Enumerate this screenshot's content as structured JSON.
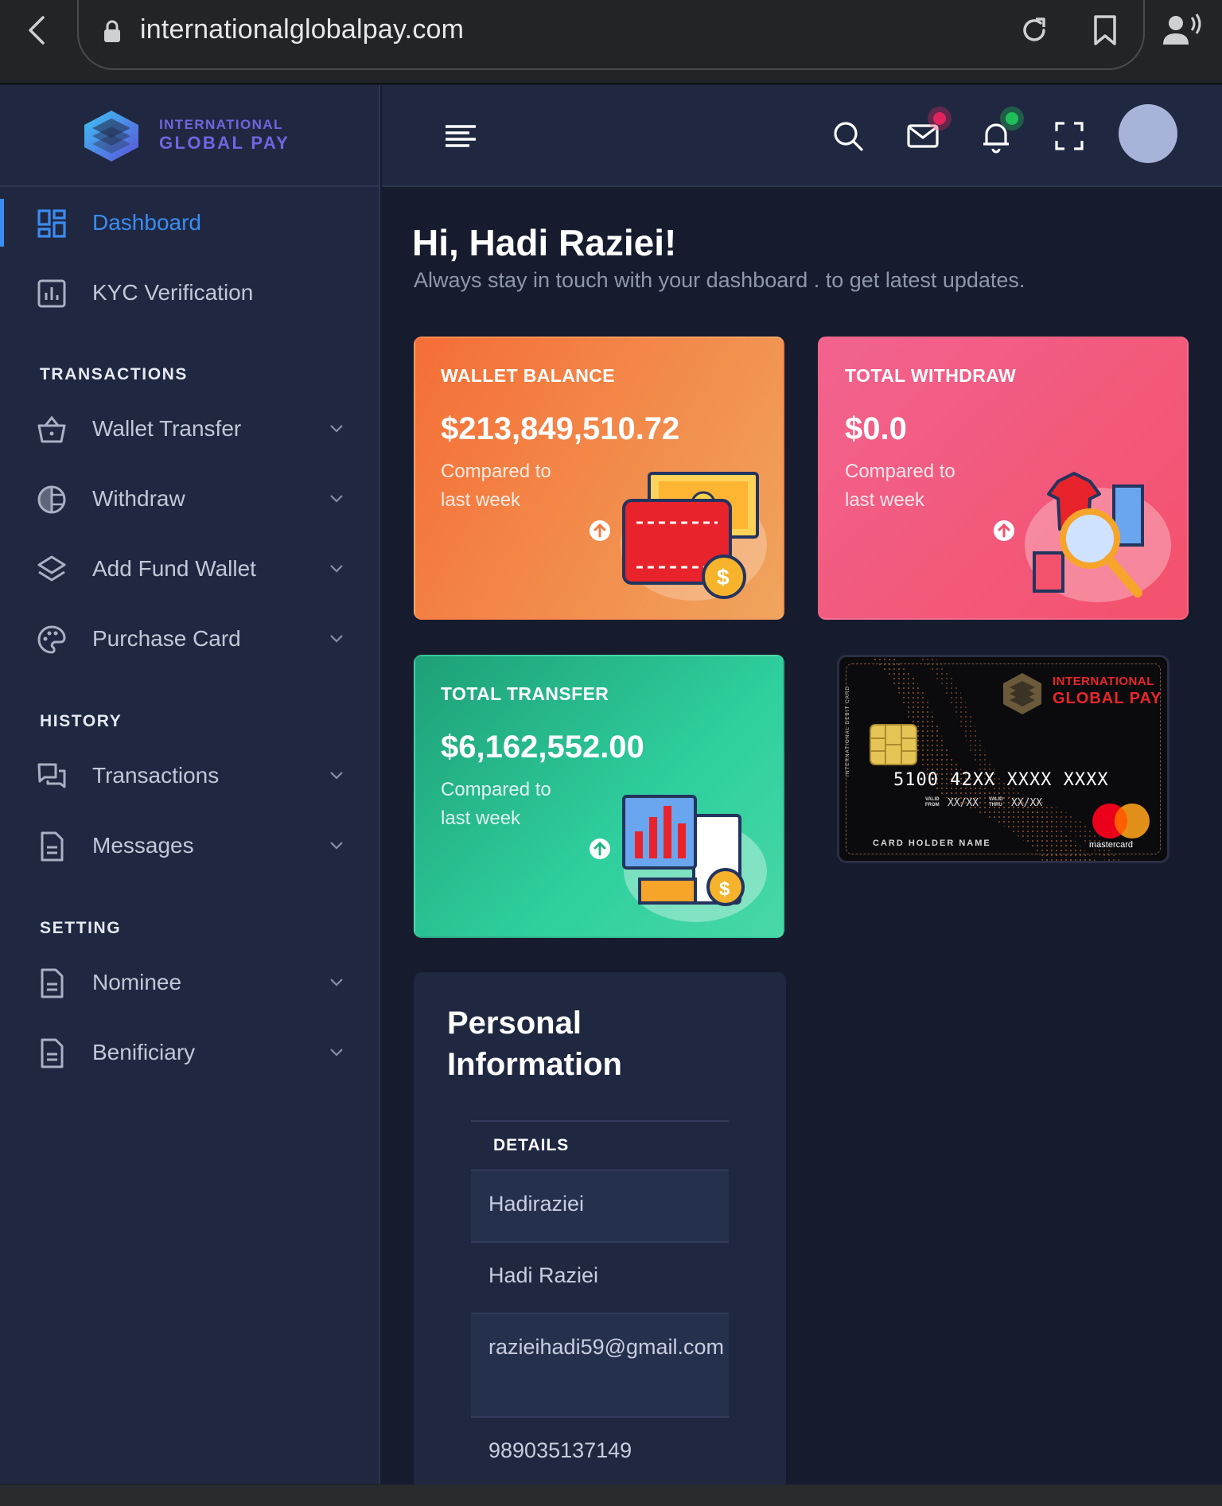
{
  "browser": {
    "url": "internationalglobalpay.com"
  },
  "brand": {
    "line1": "INTERNATIONAL",
    "line2": "GLOBAL PAY"
  },
  "sidebar": {
    "items": [
      {
        "label": "Dashboard",
        "icon": "dashboard-icon"
      },
      {
        "label": "KYC Verification",
        "icon": "bar-chart-icon"
      }
    ],
    "sections": [
      {
        "title": "TRANSACTIONS",
        "items": [
          {
            "label": "Wallet Transfer",
            "icon": "basket-icon"
          },
          {
            "label": "Withdraw",
            "icon": "pie-chart-icon"
          },
          {
            "label": "Add Fund Wallet",
            "icon": "layers-icon"
          },
          {
            "label": "Purchase Card",
            "icon": "palette-icon"
          }
        ]
      },
      {
        "title": "HISTORY",
        "items": [
          {
            "label": "Transactions",
            "icon": "chat-icon"
          },
          {
            "label": "Messages",
            "icon": "document-icon"
          }
        ]
      },
      {
        "title": "SETTING",
        "items": [
          {
            "label": "Nominee",
            "icon": "document-icon"
          },
          {
            "label": "Benificiary",
            "icon": "document-icon"
          }
        ]
      }
    ]
  },
  "header": {
    "icons": [
      "menu-icon",
      "search-icon",
      "mail-icon",
      "bell-icon",
      "fullscreen-icon",
      "avatar"
    ],
    "mail_badge_color": "#e0245e",
    "bell_badge_color": "#1fbf5a"
  },
  "main": {
    "greeting": "Hi, Hadi Raziei!",
    "subtitle": "Always stay in touch with your dashboard . to get latest updates.",
    "cards": [
      {
        "title": "WALLET BALANCE",
        "value": "$213,849,510.72",
        "note": "Compared to last week"
      },
      {
        "title": "TOTAL WITHDRAW",
        "value": "$0.0",
        "note": "Compared to last week"
      },
      {
        "title": "TOTAL TRANSFER",
        "value": "$6,162,552.00",
        "note": "Compared to last week"
      }
    ],
    "debit_card": {
      "brand1": "INTERNATIONAL",
      "brand2": "GLOBAL PAY",
      "number": "5100 42XX XXXX XXXX",
      "valid_from_label": "VALID FROM",
      "valid_from": "XX/XX",
      "valid_thru_label": "VALID THRU",
      "valid_thru": "XX/XX",
      "holder_label": "CARD HOLDER NAME",
      "side_text": "INTERNATIONAL DEBIT CARD",
      "network": "mastercard"
    },
    "personal_info": {
      "title": "Personal Information",
      "header": "DETAILS",
      "rows": [
        "Hadiraziei",
        "Hadi Raziei",
        "razieihadi59@gmail.com",
        "989035137149"
      ]
    }
  },
  "colors": {
    "accent": "#3c8bf1",
    "wallet": "#f56e37",
    "withdraw": "#f4516c",
    "transfer": "#2fcf9e"
  }
}
